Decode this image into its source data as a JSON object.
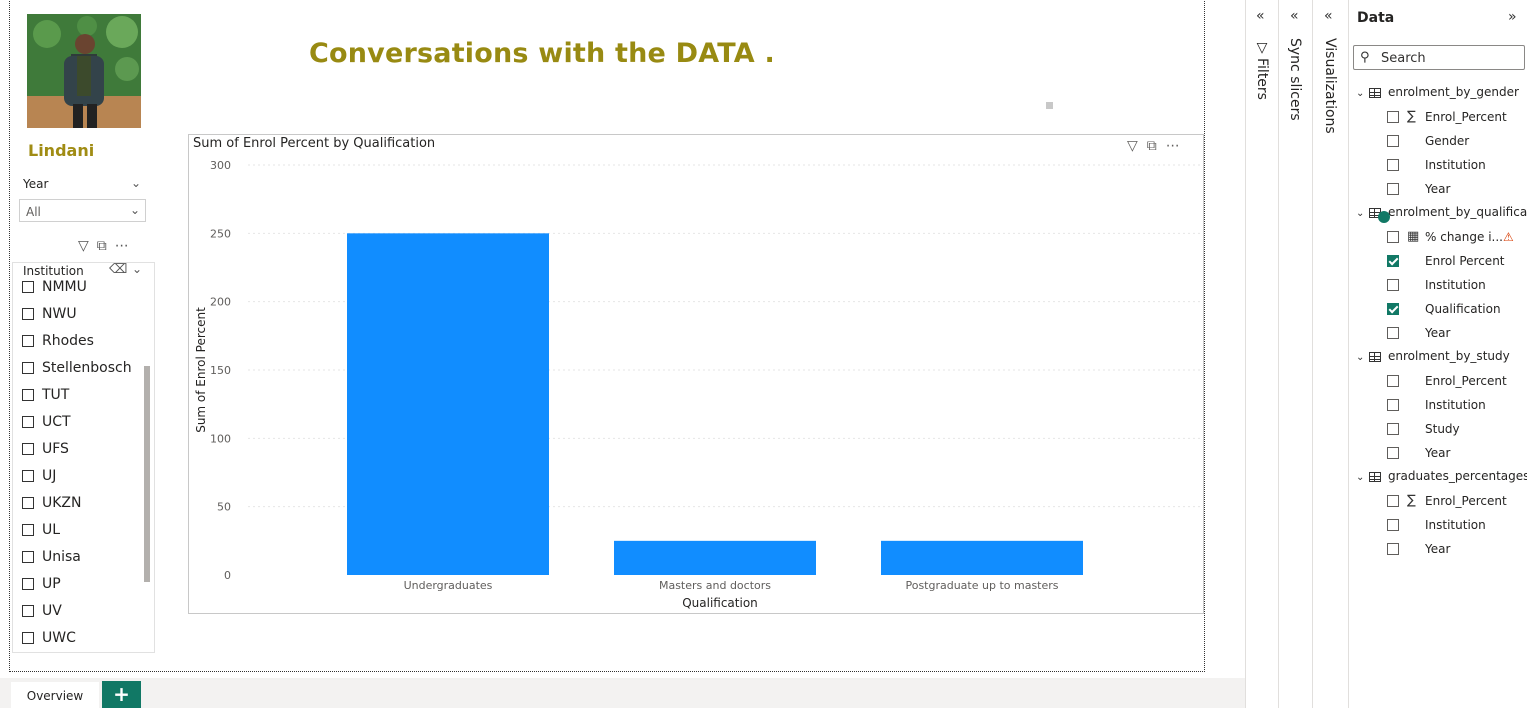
{
  "report": {
    "author": "Lindani",
    "title": "Conversations with the DATA ."
  },
  "year_slicer": {
    "label": "Year",
    "selected": "All"
  },
  "institution_slicer": {
    "label": "Institution",
    "items": [
      "NMMU",
      "NWU",
      "Rhodes",
      "Stellenbosch",
      "TUT",
      "UCT",
      "UFS",
      "UJ",
      "UKZN",
      "UL",
      "Unisa",
      "UP",
      "UV",
      "UWC"
    ]
  },
  "chart_data": {
    "type": "bar",
    "title": "Sum of Enrol Percent by Qualification",
    "xlabel": "Qualification",
    "ylabel": "Sum of Enrol Percent",
    "categories": [
      "Undergraduates",
      "Masters and doctors",
      "Postgraduate up to masters"
    ],
    "values": [
      250,
      25,
      25
    ],
    "ylim": [
      0,
      300
    ],
    "yticks": [
      0,
      50,
      100,
      150,
      200,
      250,
      300
    ],
    "grid": true,
    "color": "#118DFF"
  },
  "tabs": {
    "overview": "Overview",
    "add": "+"
  },
  "panes": {
    "filters": "Filters",
    "sync_slicers": "Sync slicers",
    "visualizations": "Visualizations"
  },
  "data_pane": {
    "title": "Data",
    "search_placeholder": "Search",
    "tables": [
      {
        "name": "enrolment_by_gender",
        "fields": [
          {
            "name": "Enrol_Percent",
            "checked": false,
            "sigma": true
          },
          {
            "name": "Gender",
            "checked": false
          },
          {
            "name": "Institution",
            "checked": false
          },
          {
            "name": "Year",
            "checked": false
          }
        ]
      },
      {
        "name": "enrolment_by_qualifica...",
        "fields": [
          {
            "name": "% change i...",
            "checked": false,
            "measure": true,
            "warning": true
          },
          {
            "name": "Enrol Percent",
            "checked": true
          },
          {
            "name": "Institution",
            "checked": false
          },
          {
            "name": "Qualification",
            "checked": true
          },
          {
            "name": "Year",
            "checked": false
          }
        ]
      },
      {
        "name": "enrolment_by_study",
        "fields": [
          {
            "name": "Enrol_Percent",
            "checked": false
          },
          {
            "name": "Institution",
            "checked": false
          },
          {
            "name": "Study",
            "checked": false
          },
          {
            "name": "Year",
            "checked": false
          }
        ]
      },
      {
        "name": "graduates_percentages",
        "fields": [
          {
            "name": "Enrol_Percent",
            "checked": false,
            "sigma": true
          },
          {
            "name": "Institution",
            "checked": false
          },
          {
            "name": "Year",
            "checked": false
          }
        ]
      }
    ]
  }
}
